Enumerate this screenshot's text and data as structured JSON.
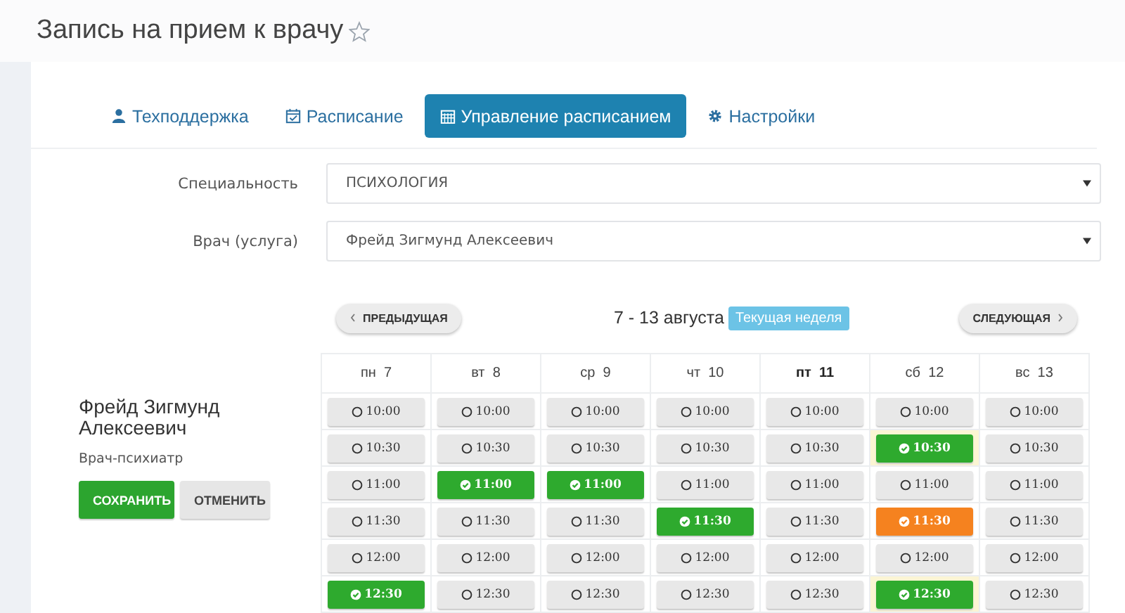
{
  "page_title": "Запись на прием к врачу",
  "favorite": false,
  "tabs": [
    {
      "label": "Техподдержка",
      "selected": false
    },
    {
      "label": "Расписание",
      "selected": false
    },
    {
      "label": "Управление расписанием",
      "selected": true
    },
    {
      "label": "Настройки",
      "selected": false
    }
  ],
  "form": [
    {
      "label": "Специальность",
      "value": "ПСИХОЛОГИЯ"
    },
    {
      "label": "Врач (услуга)",
      "value": "Фрейд Зигмунд Алексеевич"
    }
  ],
  "doctor": {
    "name": "Фрейд Зигмунд Алексеевич",
    "role": "Врач-психиатр"
  },
  "actions": [
    {
      "label": "СОХРАНИТЬ",
      "kind": "primary"
    },
    {
      "label": "ОТМЕНИТЬ",
      "kind": "default"
    }
  ],
  "week": {
    "prev": "ПРЕДЫДУЩАЯ",
    "range": "7 - 13 августа",
    "badge": "Текущая неделя",
    "next": "СЛЕДУЮЩАЯ"
  },
  "days": [
    {
      "name": "пн",
      "date": "7",
      "today": false
    },
    {
      "name": "вт",
      "date": "8",
      "today": false
    },
    {
      "name": "ср",
      "date": "9",
      "today": false
    },
    {
      "name": "чт",
      "date": "10",
      "today": false
    },
    {
      "name": "пт",
      "date": "11",
      "today": true
    },
    {
      "name": "сб",
      "date": "12",
      "today": false
    },
    {
      "name": "вс",
      "date": "13",
      "today": false
    }
  ],
  "rows": [
    [
      {
        "time": "10:00",
        "kind": "free",
        "marked": false
      },
      {
        "time": "10:00",
        "kind": "free",
        "marked": false
      },
      {
        "time": "10:00",
        "kind": "free",
        "marked": false
      },
      {
        "time": "10:00",
        "kind": "free",
        "marked": false
      },
      {
        "time": "10:00",
        "kind": "free",
        "marked": false
      },
      {
        "time": "10:00",
        "kind": "free",
        "marked": false
      },
      {
        "time": "10:00",
        "kind": "free",
        "marked": false
      }
    ],
    [
      {
        "time": "10:30",
        "kind": "free",
        "marked": false
      },
      {
        "time": "10:30",
        "kind": "free",
        "marked": false
      },
      {
        "time": "10:30",
        "kind": "free",
        "marked": false
      },
      {
        "time": "10:30",
        "kind": "free",
        "marked": false
      },
      {
        "time": "10:30",
        "kind": "free",
        "marked": false
      },
      {
        "time": "10:30",
        "kind": "booked",
        "marked": true
      },
      {
        "time": "10:30",
        "kind": "free",
        "marked": false
      }
    ],
    [
      {
        "time": "11:00",
        "kind": "free",
        "marked": false
      },
      {
        "time": "11:00",
        "kind": "booked",
        "marked": false
      },
      {
        "time": "11:00",
        "kind": "booked",
        "marked": false
      },
      {
        "time": "11:00",
        "kind": "free",
        "marked": false
      },
      {
        "time": "11:00",
        "kind": "free",
        "marked": false
      },
      {
        "time": "11:00",
        "kind": "free",
        "marked": false
      },
      {
        "time": "11:00",
        "kind": "free",
        "marked": false
      }
    ],
    [
      {
        "time": "11:30",
        "kind": "free",
        "marked": false
      },
      {
        "time": "11:30",
        "kind": "free",
        "marked": false
      },
      {
        "time": "11:30",
        "kind": "free",
        "marked": false
      },
      {
        "time": "11:30",
        "kind": "booked",
        "marked": false
      },
      {
        "time": "11:30",
        "kind": "free",
        "marked": false
      },
      {
        "time": "11:30",
        "kind": "pending",
        "marked": false
      },
      {
        "time": "11:30",
        "kind": "free",
        "marked": false
      }
    ],
    [
      {
        "time": "12:00",
        "kind": "free",
        "marked": false
      },
      {
        "time": "12:00",
        "kind": "free",
        "marked": false
      },
      {
        "time": "12:00",
        "kind": "free",
        "marked": false
      },
      {
        "time": "12:00",
        "kind": "free",
        "marked": false
      },
      {
        "time": "12:00",
        "kind": "free",
        "marked": false
      },
      {
        "time": "12:00",
        "kind": "free",
        "marked": false
      },
      {
        "time": "12:00",
        "kind": "free",
        "marked": false
      }
    ],
    [
      {
        "time": "12:30",
        "kind": "booked",
        "marked": false
      },
      {
        "time": "12:30",
        "kind": "free",
        "marked": false
      },
      {
        "time": "12:30",
        "kind": "free",
        "marked": false
      },
      {
        "time": "12:30",
        "kind": "free",
        "marked": false
      },
      {
        "time": "12:30",
        "kind": "free",
        "marked": false
      },
      {
        "time": "12:30",
        "kind": "booked",
        "marked": true
      },
      {
        "time": "12:30",
        "kind": "free",
        "marked": false
      }
    ]
  ]
}
